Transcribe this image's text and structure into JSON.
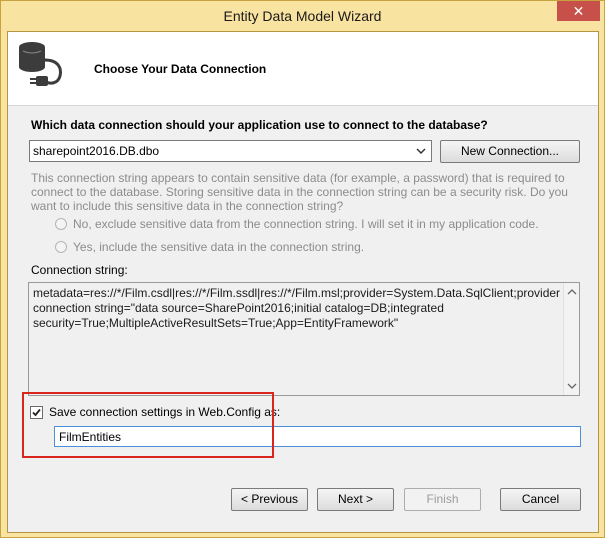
{
  "window": {
    "title": "Entity Data Model Wizard",
    "close_label": "✕"
  },
  "header": {
    "icon": "database-connection-icon",
    "heading": "Choose Your Data Connection"
  },
  "connection": {
    "question": "Which data connection should your application use to connect to the database?",
    "selected": "sharepoint2016.DB.dbo",
    "new_connection_label": "New Connection..."
  },
  "sensitive": {
    "info": "This connection string appears to contain sensitive data (for example, a password) that is required to connect to the database. Storing sensitive data in the connection string can be a security risk. Do you want to include this sensitive data in the connection string?",
    "option_no": "No, exclude sensitive data from the connection string. I will set it in my application code.",
    "option_yes": "Yes, include the sensitive data in the connection string."
  },
  "connection_string": {
    "label": "Connection string:",
    "value": "metadata=res://*/Film.csdl|res://*/Film.ssdl|res://*/Film.msl;provider=System.Data.SqlClient;provider connection string=\"data source=SharePoint2016;initial catalog=DB;integrated security=True;MultipleActiveResultSets=True;App=EntityFramework\""
  },
  "save": {
    "label": "Save connection settings in Web.Config as:",
    "checked": true,
    "value": "FilmEntities"
  },
  "footer": {
    "previous": "< Previous",
    "next": "Next >",
    "finish": "Finish",
    "cancel": "Cancel"
  },
  "colors": {
    "title_bar": "#f9e3a0",
    "close_button": "#c7504b",
    "highlight": "#d9261c"
  }
}
